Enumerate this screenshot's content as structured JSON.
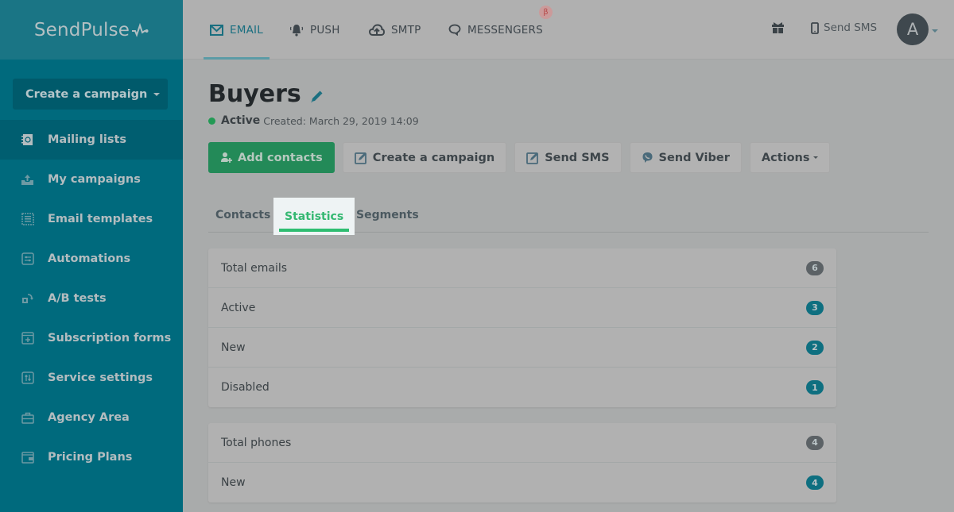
{
  "brand": {
    "name": "SendPulse"
  },
  "sidebar": {
    "create_button": {
      "label": "Create a campaign"
    },
    "items": [
      {
        "label": "Mailing lists",
        "icon": "mailing-list-icon",
        "active": true
      },
      {
        "label": "My campaigns",
        "icon": "upload-tray-icon"
      },
      {
        "label": "Email templates",
        "icon": "template-icon"
      },
      {
        "label": "Automations",
        "icon": "automation-icon"
      },
      {
        "label": "A/B tests",
        "icon": "ab-test-icon"
      },
      {
        "label": "Subscription forms",
        "icon": "form-icon"
      },
      {
        "label": "Service settings",
        "icon": "settings-sliders-icon"
      },
      {
        "label": "Agency Area",
        "icon": "briefcase-icon"
      },
      {
        "label": "Pricing Plans",
        "icon": "wallet-icon"
      }
    ]
  },
  "topbar": {
    "tabs": [
      {
        "label": "EMAIL",
        "icon": "envelope-icon",
        "active": true
      },
      {
        "label": "PUSH",
        "icon": "bell-icon"
      },
      {
        "label": "SMTP",
        "icon": "cloud-upload-icon"
      },
      {
        "label": "MESSENGERS",
        "icon": "chat-bubble-icon",
        "badge": "β"
      }
    ],
    "gift_icon": "gift-icon",
    "send_sms": "Send SMS",
    "avatar_initial": "A"
  },
  "page": {
    "title": "Buyers",
    "status": "Active",
    "created": "Created: March 29, 2019 14:09",
    "actions": [
      {
        "label": "Add contacts",
        "icon": "add-user-icon",
        "primary": true
      },
      {
        "label": "Create a campaign",
        "icon": "edit-square-icon"
      },
      {
        "label": "Send SMS",
        "icon": "edit-square-icon"
      },
      {
        "label": "Send Viber",
        "icon": "viber-icon"
      },
      {
        "label": "Actions",
        "dropdown": true
      }
    ],
    "tabs": [
      {
        "label": "Contacts"
      },
      {
        "label": "Statistics",
        "active": true
      },
      {
        "label": "Segments"
      }
    ]
  },
  "stats": {
    "emails": [
      {
        "label": "Total emails",
        "value": "6",
        "color": "gray"
      },
      {
        "label": "Active",
        "value": "3",
        "color": "teal"
      },
      {
        "label": "New",
        "value": "2",
        "color": "teal"
      },
      {
        "label": "Disabled",
        "value": "1",
        "color": "teal"
      }
    ],
    "phones": [
      {
        "label": "Total phones",
        "value": "4",
        "color": "gray"
      },
      {
        "label": "New",
        "value": "4",
        "color": "teal"
      }
    ]
  },
  "colors": {
    "sidebar": "#006a7d",
    "primary_green": "#238a58",
    "active_tab": "#2ebd71",
    "badge_teal": "#0e6f80",
    "badge_gray": "#5c6266"
  }
}
